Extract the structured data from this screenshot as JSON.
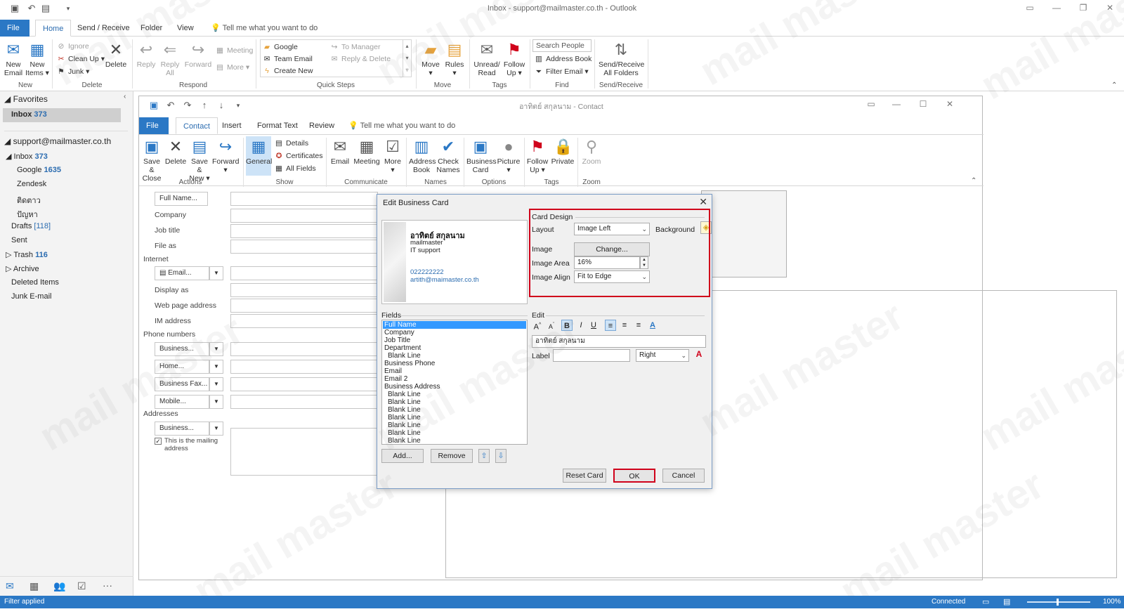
{
  "window": {
    "title": "Inbox - support@mailmaster.co.th  -  Outlook"
  },
  "tabs": [
    "File",
    "Home",
    "Send / Receive",
    "Folder",
    "View"
  ],
  "tell_me": "Tell me what you want to do",
  "ribbon": {
    "new_email": [
      "New",
      "Email"
    ],
    "new_items": [
      "New",
      "Items"
    ],
    "ignore": "Ignore",
    "clean_up": "Clean Up",
    "junk": "Junk",
    "delete": "Delete",
    "reply": "Reply",
    "reply_all": [
      "Reply",
      "All"
    ],
    "forward": "Forward",
    "meeting": "Meeting",
    "more": "More",
    "qs_google": "Google",
    "qs_team_email": "Team Email",
    "qs_create_new": "Create New",
    "qs_to_manager": "To Manager",
    "qs_reply_delete": "Reply & Delete",
    "move": "Move",
    "rules": "Rules",
    "unread_read": [
      "Unread/",
      "Read"
    ],
    "follow_up": [
      "Follow",
      "Up"
    ],
    "search_people": "Search People",
    "address_book": "Address Book",
    "filter_email": "Filter Email",
    "send_receive_all": [
      "Send/Receive",
      "All Folders"
    ],
    "groups": {
      "new": "New",
      "delete": "Delete",
      "respond": "Respond",
      "quick_steps": "Quick Steps",
      "move": "Move",
      "tags": "Tags",
      "find": "Find",
      "send_receive": "Send/Receive"
    }
  },
  "nav": {
    "favorites": "Favorites",
    "inbox_fav": "Inbox",
    "inbox_fav_count": "373",
    "account": "support@mailmaster.co.th",
    "inbox": "Inbox",
    "inbox_count": "373",
    "google": "Google",
    "google_count": "1635",
    "zendesk": "Zendesk",
    "thai1": "ติดตาว",
    "thai2": "ปัญหา",
    "drafts": "Drafts",
    "drafts_count": "[118]",
    "sent": "Sent",
    "trash": "Trash",
    "trash_count": "116",
    "archive": "Archive",
    "deleted_items": "Deleted Items",
    "junk_email": "Junk E-mail"
  },
  "status": {
    "left": "Filter applied",
    "connected": "Connected",
    "zoom": "100%"
  },
  "contact": {
    "title": "อาทิตย์ สกุลนาม  -  Contact",
    "tabs": [
      "File",
      "Contact",
      "Insert",
      "Format Text",
      "Review"
    ],
    "tell_me": "Tell me what you want to do",
    "ribbon": {
      "save_close": [
        "Save &",
        "Close"
      ],
      "delete": "Delete",
      "save_new": [
        "Save &",
        "New"
      ],
      "forward": "Forward",
      "general": "General",
      "details": "Details",
      "certificates": "Certificates",
      "all_fields": "All Fields",
      "email": "Email",
      "meeting": "Meeting",
      "more": "More",
      "address_book": [
        "Address",
        "Book"
      ],
      "check_names": [
        "Check",
        "Names"
      ],
      "business_card": [
        "Business",
        "Card"
      ],
      "picture": "Picture",
      "follow_up": [
        "Follow",
        "Up"
      ],
      "private": "Private",
      "zoom": "Zoom",
      "groups": {
        "actions": "Actions",
        "show": "Show",
        "communicate": "Communicate",
        "names": "Names",
        "options": "Options",
        "tags": "Tags",
        "zoom": "Zoom"
      }
    },
    "form": {
      "full_name": "Full Name...",
      "company": "Company",
      "job_title": "Job title",
      "file_as": "File as",
      "internet": "Internet",
      "email": "Email...",
      "display_as": "Display as",
      "web_page": "Web page address",
      "im_address": "IM address",
      "phone_numbers": "Phone numbers",
      "business": "Business...",
      "home": "Home...",
      "business_fax": "Business Fax...",
      "mobile": "Mobile...",
      "addresses": "Addresses",
      "address_business": "Business...",
      "mailing": [
        "This is the mailing",
        "address"
      ]
    }
  },
  "dialog": {
    "title": "Edit Business Card",
    "card": {
      "name": "อาทิตย์ สกุลนาม",
      "company": "mailmaster",
      "job": "IT support",
      "phone": "022222222",
      "email": "artith@maimaster.co.th"
    },
    "card_design": "Card Design",
    "layout_label": "Layout",
    "layout_value": "Image Left",
    "background_label": "Background",
    "image_label": "Image",
    "change_button": "Change...",
    "image_area_label": "Image Area",
    "image_area_value": "16%",
    "image_align_label": "Image Align",
    "image_align_value": "Fit to Edge",
    "fields_label": "Fields",
    "edit_label": "Edit",
    "fields": [
      "Full Name",
      "Company",
      "Job Title",
      "Department",
      "Blank Line",
      "Business Phone",
      "Email",
      "Email 2",
      "Business Address",
      "Blank Line",
      "Blank Line",
      "Blank Line",
      "Blank Line",
      "Blank Line",
      "Blank Line",
      "Blank Line"
    ],
    "edit_value": "อาทิตย์ สกุลนาม",
    "label_label": "Label",
    "label_value": "",
    "label_align": "Right",
    "add_button": "Add...",
    "remove_button": "Remove",
    "reset_card": "Reset Card",
    "ok": "OK",
    "cancel": "Cancel"
  },
  "watermark": "mail master",
  "colors": {
    "accent": "#2b78c5",
    "highlight": "#d0021b",
    "selection": "#3399ff"
  }
}
